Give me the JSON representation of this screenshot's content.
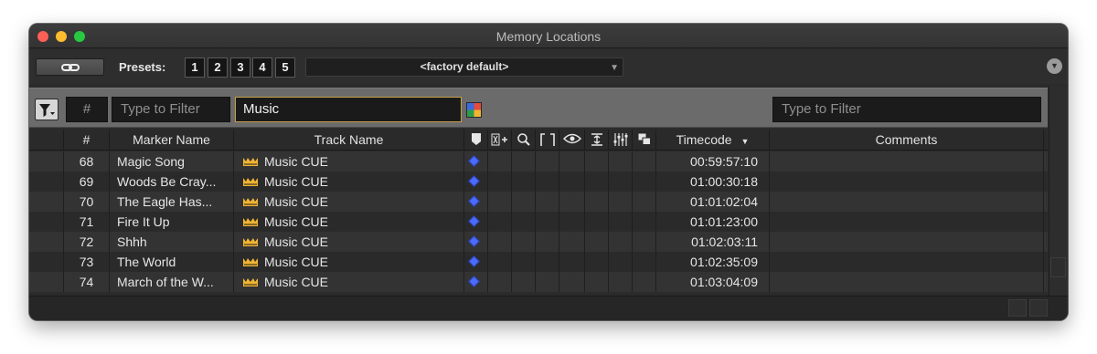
{
  "window": {
    "title": "Memory Locations"
  },
  "toolbar": {
    "link_icon": "link-icon",
    "presets_label": "Presets:",
    "preset_buttons": [
      "1",
      "2",
      "3",
      "4",
      "5"
    ],
    "preset_selected": "<factory default>"
  },
  "filters": {
    "number_label": "#",
    "name_placeholder": "Type to Filter",
    "track_value": "Music",
    "comments_placeholder": "Type to Filter"
  },
  "table": {
    "columns": {
      "number": "#",
      "marker_name": "Marker Name",
      "track_name": "Track Name",
      "timecode": "Timecode",
      "timecode_sort": "▼",
      "comments": "Comments"
    },
    "icon_columns": [
      "marker-icon",
      "track-size-icon",
      "zoom-icon",
      "selection-icon",
      "view-icon",
      "track-height-icon",
      "mix-icon",
      "window-icon"
    ],
    "rows": [
      {
        "number": "68",
        "marker_name": "Magic Song",
        "track_name": "Music CUE",
        "timecode": "00:59:57:10",
        "comments": ""
      },
      {
        "number": "69",
        "marker_name": "Woods Be Cray...",
        "track_name": "Music CUE",
        "timecode": "01:00:30:18",
        "comments": ""
      },
      {
        "number": "70",
        "marker_name": "The Eagle Has...",
        "track_name": "Music CUE",
        "timecode": "01:01:02:04",
        "comments": ""
      },
      {
        "number": "71",
        "marker_name": "Fire It Up",
        "track_name": "Music CUE",
        "timecode": "01:01:23:00",
        "comments": ""
      },
      {
        "number": "72",
        "marker_name": "Shhh",
        "track_name": "Music CUE",
        "timecode": "01:02:03:11",
        "comments": ""
      },
      {
        "number": "73",
        "marker_name": "The World",
        "track_name": "Music CUE",
        "timecode": "01:02:35:09",
        "comments": ""
      },
      {
        "number": "74",
        "marker_name": "March of the W...",
        "track_name": "Music CUE",
        "timecode": "01:03:04:09",
        "comments": ""
      }
    ]
  },
  "colors": {
    "filter_active_border": "#c8a148",
    "marker_diamond": "#4b6bff",
    "crown": "#f2b532"
  }
}
